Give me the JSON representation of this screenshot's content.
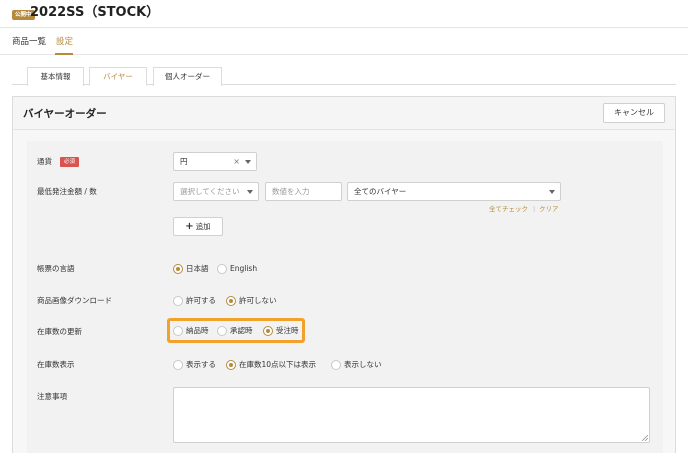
{
  "header": {
    "status_badge": "公開中",
    "title": "2022SS（STOCK）"
  },
  "nav": {
    "items": [
      {
        "label": "商品一覧",
        "active": false
      },
      {
        "label": "設定",
        "active": true
      }
    ]
  },
  "tabs": [
    {
      "label": "基本情報",
      "active": false
    },
    {
      "label": "バイヤー",
      "active": true
    },
    {
      "label": "個人オーダー",
      "active": false
    }
  ],
  "panel": {
    "title": "バイヤーオーダー",
    "cancel_label": "キャンセル"
  },
  "form": {
    "currency": {
      "label": "通貨",
      "required_badge": "必須",
      "value": "円",
      "clear_icon": "×"
    },
    "min_order": {
      "label": "最低発注金額 / 数",
      "select_placeholder": "選択してください",
      "number_placeholder": "数値を入力",
      "buyer_select_value": "全てのバイヤー",
      "check_all_label": "全てチェック",
      "separator": "|",
      "clear_label": "クリア",
      "add_plus": "+",
      "add_label": "追加"
    },
    "document_language": {
      "label": "帳票の言語",
      "options": [
        {
          "label": "日本語",
          "checked": true
        },
        {
          "label": "English",
          "checked": false
        }
      ]
    },
    "image_download": {
      "label": "商品画像ダウンロード",
      "options": [
        {
          "label": "許可する",
          "checked": false
        },
        {
          "label": "許可しない",
          "checked": true
        }
      ]
    },
    "stock_update": {
      "label": "在庫数の更新",
      "options": [
        {
          "label": "納品時",
          "checked": false
        },
        {
          "label": "承認時",
          "checked": false
        },
        {
          "label": "受注時",
          "checked": true
        }
      ],
      "highlight_color": "#f2a12a"
    },
    "stock_display": {
      "label": "在庫数表示",
      "options": [
        {
          "label": "表示する",
          "checked": false
        },
        {
          "label": "在庫数10点以下は表示",
          "checked": true
        },
        {
          "label": "表示しない",
          "checked": false
        }
      ]
    },
    "notes": {
      "label": "注意事項",
      "value": ""
    }
  },
  "colors": {
    "accent": "#b58a3e",
    "required": "#d9534f",
    "highlight": "#f2a12a"
  }
}
